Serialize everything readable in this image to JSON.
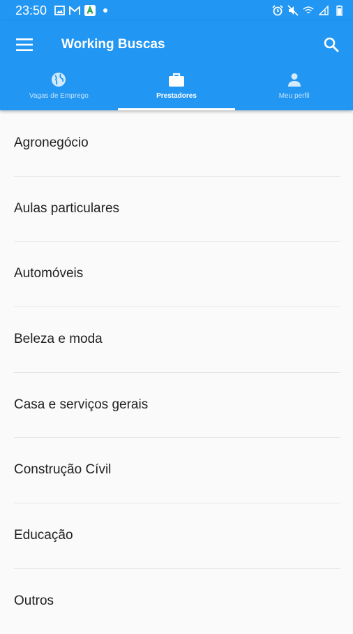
{
  "status_bar": {
    "time": "23:50",
    "left_icons": [
      "image-icon",
      "gmail-icon",
      "app-icon",
      "dot-icon"
    ],
    "right_icons": [
      "alarm-icon",
      "mute-icon",
      "wifi-icon",
      "signal-icon",
      "battery-icon"
    ]
  },
  "app_bar": {
    "title": "Working Buscas",
    "menu_icon": "menu-icon",
    "search_icon": "search-icon",
    "color": "#2196f3"
  },
  "tabs": [
    {
      "label": "Vagas de Emprego",
      "icon": "globe-icon",
      "active": false
    },
    {
      "label": "Prestadores",
      "icon": "briefcase-icon",
      "active": true
    },
    {
      "label": "Meu perfil",
      "icon": "person-icon",
      "active": false
    }
  ],
  "categories": [
    "Agronegócio",
    "Aulas particulares",
    "Automóveis",
    "Beleza e moda",
    "Casa e serviços gerais",
    "Construção Cívil",
    "Educação",
    "Outros"
  ]
}
